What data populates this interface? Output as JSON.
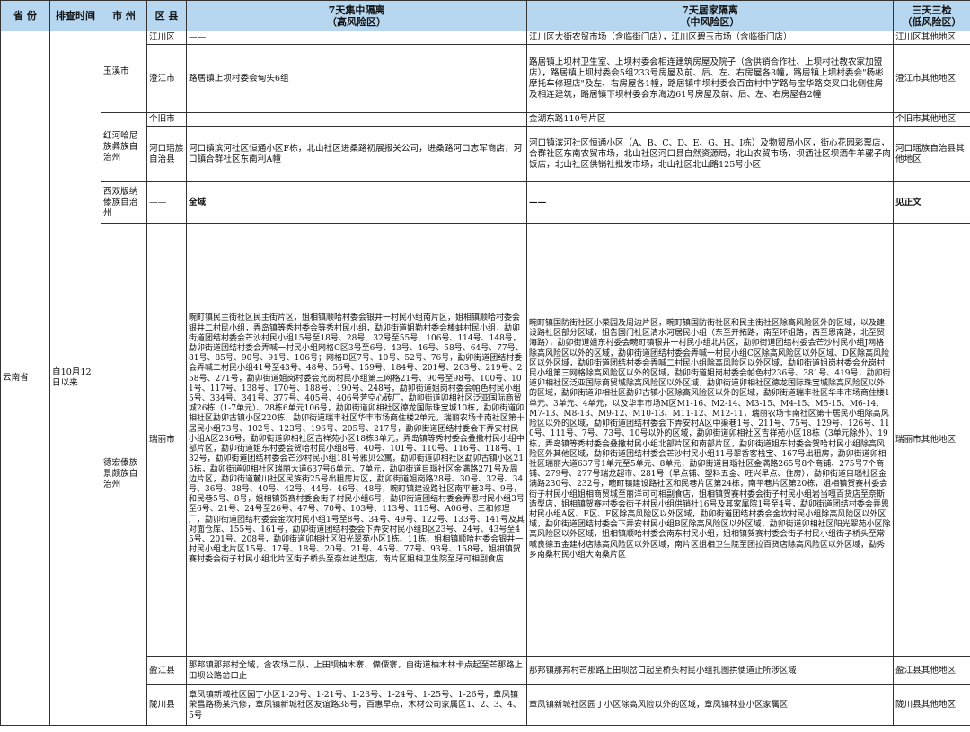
{
  "header": {
    "province": "省 份",
    "time": "排查时间",
    "city": "市 州",
    "district": "区 县",
    "high_line1": "7天集中隔离",
    "high_line2": "（高风险区）",
    "mid_line1": "7天居家隔离",
    "mid_line2": "（中风险区）",
    "low_line1": "三天三检",
    "low_line2": "（低风险区）"
  },
  "province": "云南省",
  "time": "自10月12日以来",
  "rows": [
    {
      "city": "玉溪市",
      "districts": [
        {
          "name": "江川区",
          "high": "——",
          "mid": "江川区大街农贸市场（含临街门店），江川区碧玉市场（含临街门店）",
          "low": "江川区其他地区"
        },
        {
          "name": "澄江市",
          "high": "路居镇上坝村委会甸头6组",
          "mid": "路居镇上坝村卫生室、上坝村委会相连建筑房屋及院子（含供销合作社、上坝村社教农家加盟店），路居镇上坝村委会5组233号房屋及前、后、左、右房屋各3幢，路居镇上坝村委会\"杨彬摩托车修理店\"及左、右房屋各1幢，路居镇中坝村委会百亩村中学路与宝华路交叉口北侧住房及相连建筑，路居镇下坝村委会东海边61号房屋及前、后、左、右房屋各2幢",
          "low": "澄江市其他地区"
        }
      ]
    },
    {
      "city": "红河哈尼族彝族自治州",
      "districts": [
        {
          "name": "个旧市",
          "high": "——",
          "mid": "金湖东路110号片区",
          "low": "个旧市其他地区"
        },
        {
          "name": "河口瑶族自治县",
          "high": "河口镇滨河社区恒通小区F栋，北山社区进桑路初展报关公司，进桑路河口志军商店，河口镇合群社区东南利A幢",
          "mid": "河口镇滨河社区恒通小区（A、B、C、D、E、G、H、I栋）及物贸局小区，街心花园彩票店，合群社区东南农贸市场，北山社区河口县自然资源局，北山农贸市场，坝洒社区坝洒牛羊骡子肉饭店，北山社区供销社批发市场，北山社区北山路125号小区",
          "low": "河口瑶族自治县其他地区"
        }
      ]
    },
    {
      "city": "西双版纳傣族自治州",
      "districts": [
        {
          "name": "——",
          "high": "全域",
          "mid": "——",
          "low": "见正文"
        }
      ]
    },
    {
      "city": "德宏傣族景颇族自治州",
      "districts": [
        {
          "name": "瑞丽市",
          "high": "畹町镇民主街社区民主街片区，姐相镇顺哈村委会银井一村民小组南片区，姐相镇顺哈村委会银井二村民小组，弄岛镇等秀村委会等秀村民小组，勐卯街道姐勒村委会棒蚌村民小组，勐卯街道团结村委会芒沙村民小组15号至18号、28号、32号至55号、106号、114号、148号，勐卯街道团结村委会弄喊一村民小组网格C区3号至6号、43号、46号、58号、64号、77号、81号、85号、90号、91号、106号；网格D区7号、10号、52号、76号，勐卯街道团结村委会弄喊二村民小组41号至43号、48号、56号、159号、184号、201号、203号、219号、258号、271号，勐卯街道姐岗村委会允岗村民小组第三网格21号、90号至98号、100号、101号、117号、138号、170号、188号、190号、248号，勐卯街道姐岗村委会帕色村民小组5号、334号、341号、377号、405号、406号芳空心砖厂，勐卯街道卯相社区泛亚国际商贸城26栋（1-7单元）、28栋6单元106号，勐卯街道卯相社区德龙国际珠宝城10栋，勐卯街道卯相社区勐卯古镇小区220栋，勐卯街道瑞丰社区华丰市场商住楼2单元，瑞丽农场卡南社区第十居民小组73号、102号、123号、196号、205号、217号，勐卯街道团结村委会下弄安村民小组A区236号，勐卯街道卯相社区吉祥苑小区18栋3单元，弄岛镇等秀村委会叠撒村民小组中部片区，勐卯街道姐东村委会贺哈村民小组8号、40号、101号、110号、116号、118号、132号，勐卯街道团结村委会芒沙村民小组181号雅贝公寓，勐卯街道卯相社区勐卯古镇小区215栋，勐卯街道卯相社区瑞丽大道637号6单元、7单元，勐卯街道目瑙社区金满路271号及周边片区，勐卯街道麓川社区民族街25号出租房片区，勐卯街道姐岗路28号、30号、32号、34号、36号、38号、40号、42号、44号、46号、48号，畹町镇建设路社区南平巷3号、9号，和民巷5号、8号，姐相镇贺赛村委会街子村民小组6号，勐卯街道团结村委会弄恩村民小组3号至6号、21号、24号至26号、47号、70号、103号、113号、115号、A06号、三和修理厂，勐卯街道团结村委会金坎村民小组1号至8号、34号、49号、122号、133号、141号及其对面仓库、155号、161号，勐卯街道团结村委会下弄安村民小组B区23号、24号、43号至45号、201号、208号，勐卯街道卯相社区阳光翠苑小区1栋、11栋，姐相镇顺哈村委会银井一村民小组北片区15号、17号、18号、20号、21号、45号、77号、93号、158号，姐相镇贺赛村委会街子村民小组北片区街子桥头至奈丝迪型店，南片区姐相卫生院至牙可相副食店",
          "mid": "畹町镇国防街社区小菜园及周边片区，畹町镇国防街社区和民主街社区除高风险区外的区域，以及建设路社区部分区域，姐告国门社区清水河居民小组（东至开拓路，南至环姐路，西至恩南路，北至贸海路），勐卯街道姐东村委会畹町镇银井一村民小组北片区，勐卯街道团结村委会芒沙村民小组J网格除高风险区以外的区域，勐卯街道团结村委会弄喊一村民小组C区除高风险区以外区域、D区除高风险区以外区域，勐卯街道团结村委会弄喊二村民小组除高风险区以外区域，勐卯街道姐岗村委会允岗村民小组第三网格除高风险区以外的区域，勐卯街道姐岗村委会帕色村236号、381号、419号，勐卯街道卯相社区泛亚国际商贸城除高风险区以外区域，勐卯街道卯相社区德龙国际珠宝城除高风险区以外的区域，勐卯街道卯相社区勐卯古镇小区除高风险区以外的区域，勐卯街道瑞丰社区华丰市场商住楼1单元、3单元、4单元，以及华丰市场M区M1-16、M2-14、M3-15、M4-15、M5-15、M6-14、M7-13、M8-13、M9-12、M10-13、M11-12、M12-11，瑞丽农场卡南社区第十居民小组除高风险区以外的区域，勐卯街道团结村委会下弄安村A区中渠巷1号、211号、75号、129号、126号、110号、111号、7号、73号、10号以外的区域，勐卯街道卯相社区吉祥苑小区18栋（3单元除外）、19栋，弄岛镇等秀村委会叠撒村民小组北部片区和南部片区，勐卯街道姐东村委会贺哈村民小组除高风险区外其他区域，勐卯街道团结村委会芒沙村民小组11号翠香客栈宝、167号出租房，勐卯街道卯相社区瑞丽大道637号1单元至5单元、8单元，勐卯街道目瑙社区金满路265号8个商铺、275号7个商铺、279号、277号瑞龙超市、281号（早点铺、塑料五金、旺兴早点、住房），勐卯街道目瑙社区金满路230号、232号，畹町镇建设路社区和民巷片区第24栋，南平巷片区第20栋，姐相镇贺赛村委会街子村民小组姐相商贸城至丽洋可可相副食店，姐相镇贺赛村委会街子村民小组岩当嘎百货店至奈斯造型店，姐相镇贺赛村委会街子村民小组供销社16号及其家属院1号至4号，勐卯街道团结村委会弄恩村民小组A区、E区、F区除高风险区以外区域，勐卯街道团结村委会金坎村民小组除高风险区以外区域，勐卯街道团结村委会下弄安村民小组B区除高风险区以外区域，勐卯街道卯相社区阳光翠苑小区除高风险区以外区域，姐相镇顺哈村委会南东村民小组，姐相镇贺赛村委会街子村民小组街子桥头至常喊良德五金建材店除高风险区以外区域，南片区姐相卫生院至团拉百货店除高风险区以外区域，勐秀乡南桑村民小组大南桑片区",
          "low": "瑞丽市其他地区"
        },
        {
          "name": "盈江县",
          "high": "那邦镇那邦村全域，含农场二队、上田坝柚木寨、傈僳寨，自街道柚木林卡点起至芒那路上田坝公路岔口止",
          "mid": "那邦镇那邦村芒那路上田坝岔口起至桥头村民小组扎图拱便道止所涉区域",
          "low": "盈江县其他地区"
        },
        {
          "name": "陇川县",
          "high": "章凤镇新城社区园丁小区1-20号、1-21号、1-23号、1-24号、1-25号、1-26号，章凤镇荣昌路杨某汽修，章凤镇新城社区友谊路38号，百惠早点，木材公司家属区1、2、3、4、5号",
          "mid": "章凤镇新城社区园丁小区除高风险以外的区域，章凤镇林业小区家属区",
          "low": "陇川县其他地区"
        }
      ]
    }
  ]
}
